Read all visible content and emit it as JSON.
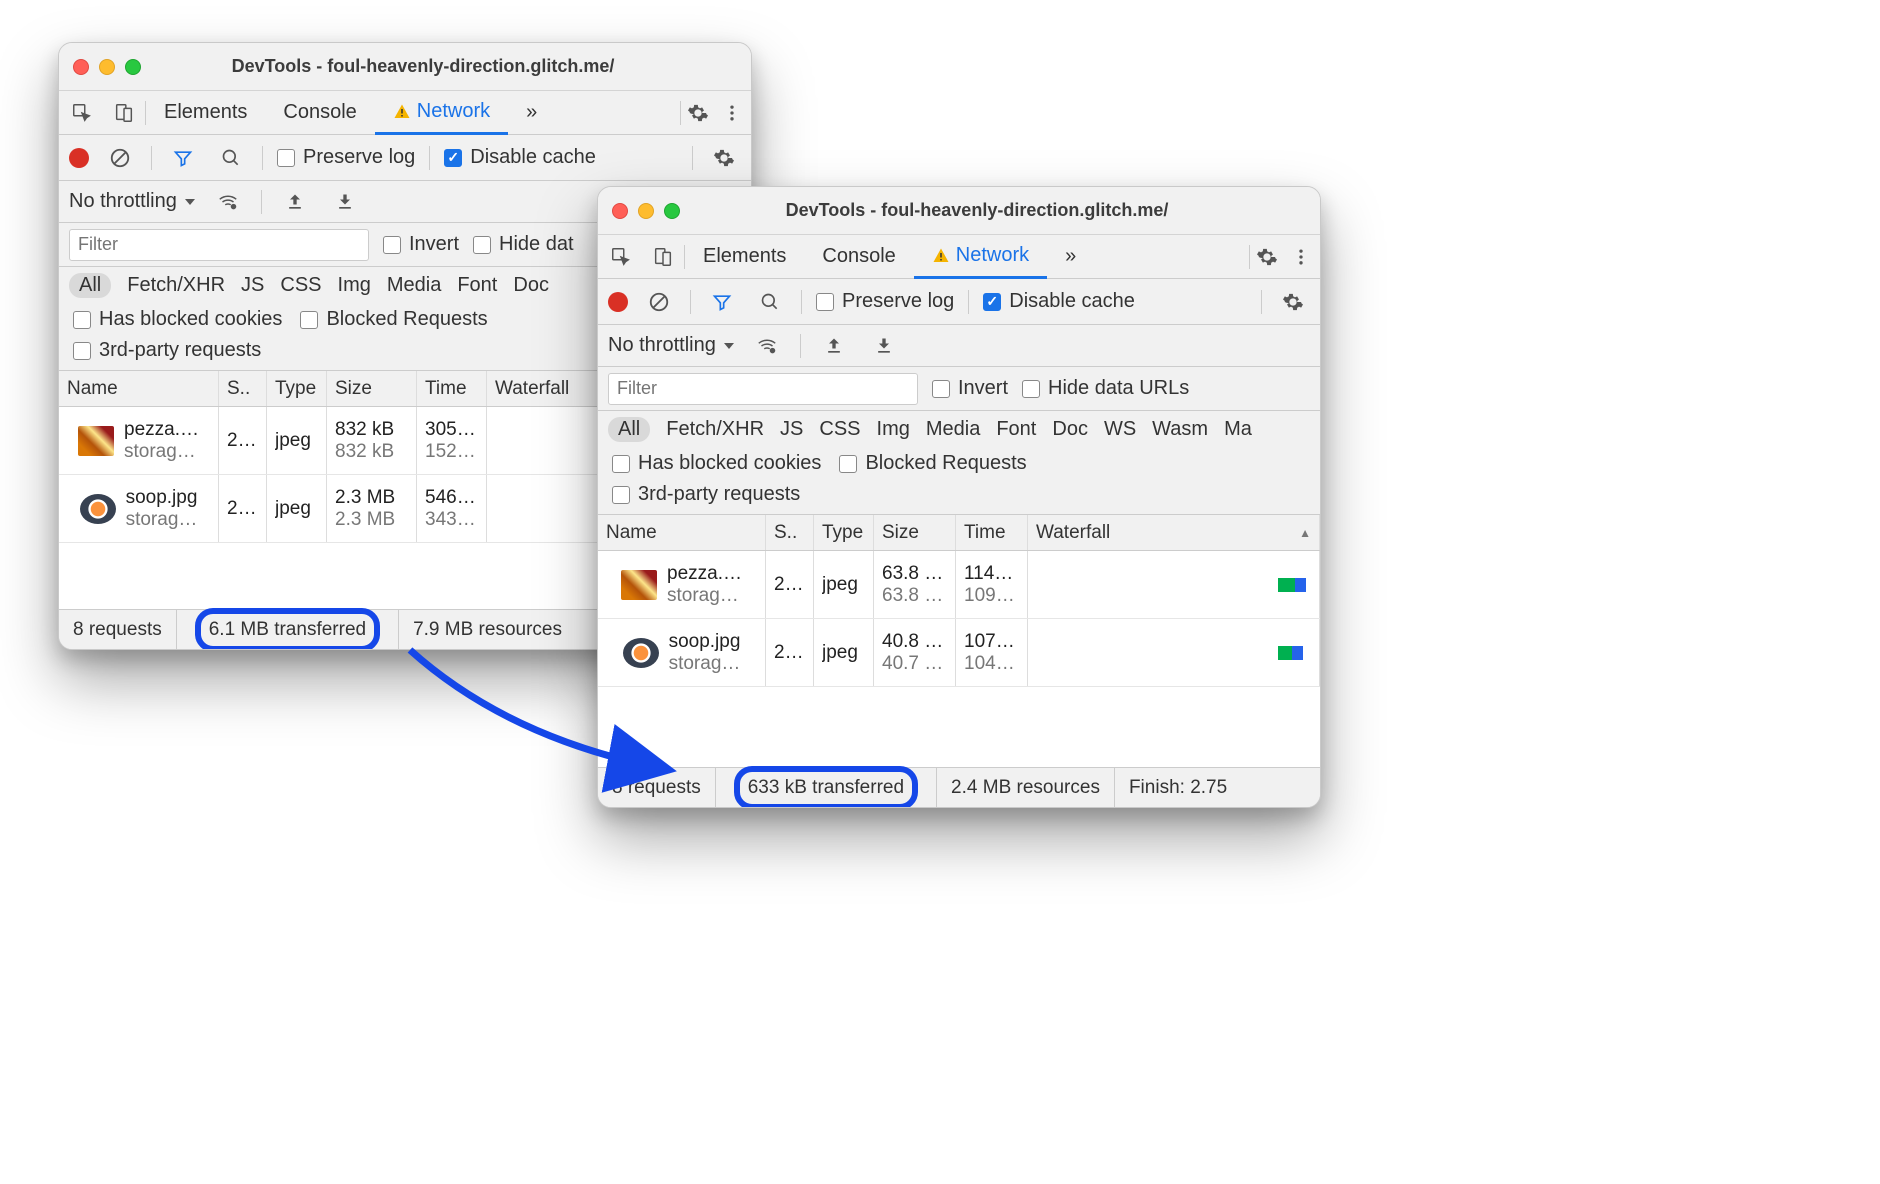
{
  "window1": {
    "title": "DevTools - foul-heavenly-direction.glitch.me/",
    "tabs": {
      "elements": "Elements",
      "console": "Console",
      "network": "Network",
      "more": "»"
    },
    "toolbar": {
      "preserve_log": "Preserve log",
      "disable_cache": "Disable cache"
    },
    "throttle": {
      "label": "No throttling"
    },
    "filter": {
      "placeholder": "Filter",
      "invert": "Invert",
      "hide_data": "Hide dat"
    },
    "types": [
      "All",
      "Fetch/XHR",
      "JS",
      "CSS",
      "Img",
      "Media",
      "Font",
      "Doc"
    ],
    "opts": {
      "blocked_cookies": "Has blocked cookies",
      "blocked_requests": "Blocked Requests",
      "third_party": "3rd-party requests"
    },
    "columns": {
      "name": "Name",
      "status": "S..",
      "type": "Type",
      "size": "Size",
      "time": "Time",
      "waterfall": "Waterfall"
    },
    "rows": [
      {
        "name": "pezza.…",
        "sub": "storag…",
        "status": "2…",
        "type": "jpeg",
        "size1": "832 kB",
        "size2": "832 kB",
        "time1": "305…",
        "time2": "152…"
      },
      {
        "name": "soop.jpg",
        "sub": "storag…",
        "status": "2…",
        "type": "jpeg",
        "size1": "2.3 MB",
        "size2": "2.3 MB",
        "time1": "546…",
        "time2": "343…"
      }
    ],
    "status": {
      "requests": "8 requests",
      "transferred": "6.1 MB transferred",
      "resources": "7.9 MB resources"
    }
  },
  "window2": {
    "title": "DevTools - foul-heavenly-direction.glitch.me/",
    "tabs": {
      "elements": "Elements",
      "console": "Console",
      "network": "Network",
      "more": "»"
    },
    "toolbar": {
      "preserve_log": "Preserve log",
      "disable_cache": "Disable cache"
    },
    "throttle": {
      "label": "No throttling"
    },
    "filter": {
      "placeholder": "Filter",
      "invert": "Invert",
      "hide_data": "Hide data URLs"
    },
    "types": [
      "All",
      "Fetch/XHR",
      "JS",
      "CSS",
      "Img",
      "Media",
      "Font",
      "Doc",
      "WS",
      "Wasm",
      "Ma"
    ],
    "opts": {
      "blocked_cookies": "Has blocked cookies",
      "blocked_requests": "Blocked Requests",
      "third_party": "3rd-party requests"
    },
    "columns": {
      "name": "Name",
      "status": "S..",
      "type": "Type",
      "size": "Size",
      "time": "Time",
      "waterfall": "Waterfall"
    },
    "rows": [
      {
        "name": "pezza.…",
        "sub": "storag…",
        "status": "2…",
        "type": "jpeg",
        "size1": "63.8 …",
        "size2": "63.8 …",
        "time1": "114…",
        "time2": "109…"
      },
      {
        "name": "soop.jpg",
        "sub": "storag…",
        "status": "2…",
        "type": "jpeg",
        "size1": "40.8 …",
        "size2": "40.7 …",
        "time1": "107…",
        "time2": "104…"
      }
    ],
    "status": {
      "requests": "8 requests",
      "transferred": "633 kB transferred",
      "resources": "2.4 MB resources",
      "finish": "Finish: 2.75"
    }
  }
}
